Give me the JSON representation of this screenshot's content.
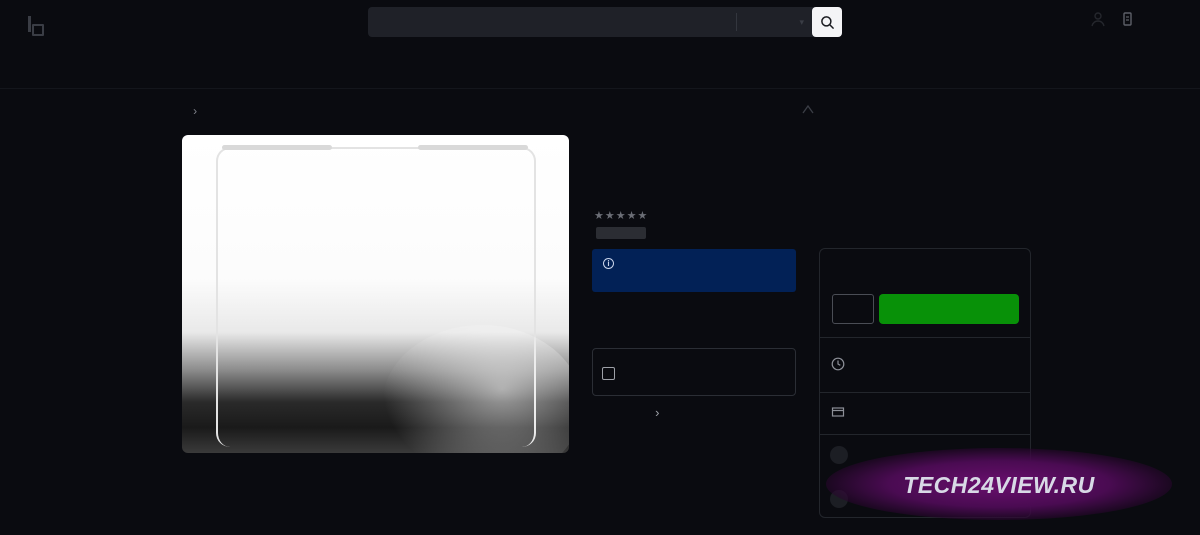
{
  "header": {
    "logo_text": "",
    "search_placeholder": "",
    "search_department": "▾"
  },
  "nav": {
    "categories": [
      "",
      "",
      "",
      "",
      "",
      "",
      "",
      "",
      "",
      "",
      "",
      "",
      "",
      ""
    ]
  },
  "breadcrumb": {
    "chevron": "›",
    "share_label": ""
  },
  "product": {
    "rating_stars": "★★★★★",
    "rating_text": "",
    "notice_icon": "i",
    "option_label": "",
    "option_small": "",
    "more_chevron": "›"
  },
  "buybox": {
    "price": "",
    "qty": "",
    "add_button": "",
    "delivery_line1": "",
    "delivery_line2": ""
  },
  "watermark": {
    "text": "TECH24VIEW.RU"
  },
  "colors": {
    "background": "#0a0b10",
    "notice_blue": "#022156",
    "add_green": "#089108",
    "watermark_purple": "#6a0f6e"
  }
}
